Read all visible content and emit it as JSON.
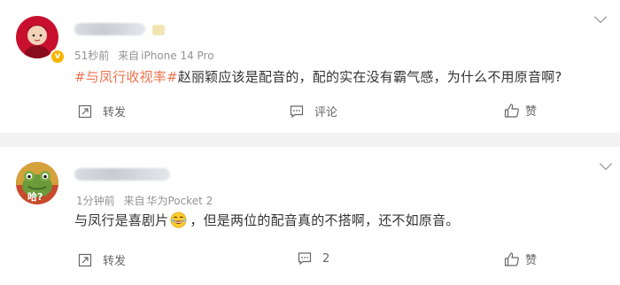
{
  "posts": [
    {
      "time": "51秒前",
      "source_prefix": "来自",
      "source": "iPhone 14 Pro",
      "topic": "#与凤行收视率#",
      "body": "赵丽颖应该是配音的，配的实在没有霸气感，为什么不用原音啊?",
      "actions": {
        "repost": "转发",
        "comment": "评论",
        "like": "赞"
      }
    },
    {
      "avatar_text": "哈?",
      "time": "1分钟前",
      "source_prefix": "来自",
      "source": "华为Pocket 2",
      "body_before": "与凤行是喜剧片",
      "body_after": "，但是两位的配音真的不搭啊，还不如原音。",
      "actions": {
        "repost": "转发",
        "comment": "2",
        "like": "赞"
      }
    }
  ],
  "colors": {
    "topic": "#eb7350",
    "meta": "#939393",
    "separator": "#f2f2f2"
  }
}
